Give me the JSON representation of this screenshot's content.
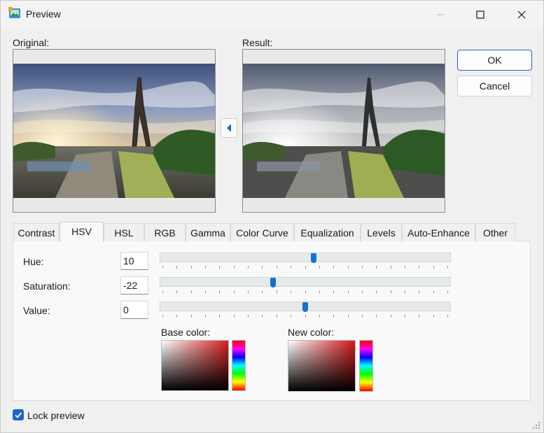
{
  "window": {
    "title": "Preview",
    "icon": "preview-app-icon",
    "controls": [
      "minimize-icon",
      "maximize-icon",
      "close-icon"
    ]
  },
  "original": {
    "label": "Original:"
  },
  "result": {
    "label": "Result:"
  },
  "copy_button": {
    "icon": "arrow-left-icon"
  },
  "buttons": {
    "ok": "OK",
    "cancel": "Cancel"
  },
  "tabs": [
    {
      "label": "Contrast",
      "active": false
    },
    {
      "label": "HSV",
      "active": true
    },
    {
      "label": "HSL",
      "active": false
    },
    {
      "label": "RGB",
      "active": false
    },
    {
      "label": "Gamma",
      "active": false
    },
    {
      "label": "Color Curve",
      "active": false
    },
    {
      "label": "Equalization",
      "active": false
    },
    {
      "label": "Levels",
      "active": false
    },
    {
      "label": "Auto-Enhance",
      "active": false
    },
    {
      "label": "Other",
      "active": false
    }
  ],
  "hsv": {
    "hue": {
      "label": "Hue:",
      "value": "10",
      "slider_fraction": 0.53
    },
    "saturation": {
      "label": "Saturation:",
      "value": "-22",
      "slider_fraction": 0.39
    },
    "value": {
      "label": "Value:",
      "value": "0",
      "slider_fraction": 0.5
    }
  },
  "colors": {
    "base_label": "Base color:",
    "new_label": "New color:",
    "base_hue_hex": "#d62020",
    "new_hue_hex": "#d41818"
  },
  "lock_preview": {
    "label": "Lock preview",
    "checked": true
  },
  "theme": {
    "accent": "#1570d0"
  }
}
